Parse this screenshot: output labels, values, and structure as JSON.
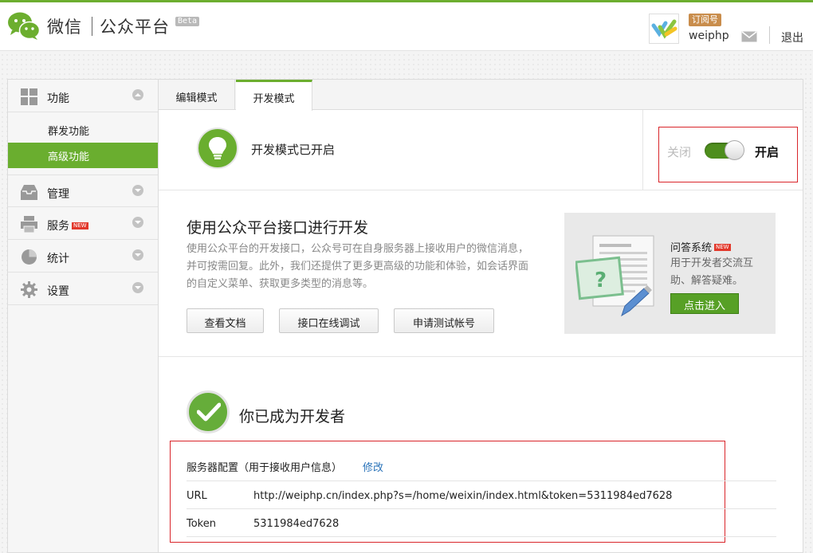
{
  "header": {
    "brand": "微信",
    "product": "公众平台",
    "beta": "Beta",
    "account_badge": "订阅号",
    "username": "weiphp",
    "logout": "退出"
  },
  "sidebar": {
    "groups": [
      {
        "label": "功能",
        "icon": "grid-icon",
        "expanded": true
      },
      {
        "label": "管理",
        "icon": "inbox-icon"
      },
      {
        "label": "服务",
        "icon": "printer-icon",
        "badge": "NEW"
      },
      {
        "label": "统计",
        "icon": "pie-chart-icon"
      },
      {
        "label": "设置",
        "icon": "gear-icon"
      }
    ],
    "sub_items": [
      {
        "label": "群发功能",
        "active": false
      },
      {
        "label": "高级功能",
        "active": true
      }
    ]
  },
  "tabs": [
    {
      "label": "编辑模式",
      "active": false
    },
    {
      "label": "开发模式",
      "active": true
    }
  ],
  "status": {
    "text": "开发模式已开启",
    "off_label": "关闭",
    "on_label": "开启",
    "enabled": true
  },
  "api": {
    "title": "使用公众平台接口进行开发",
    "description": "使用公众平台的开发接口，公众号可在自身服务器上接收用户的微信消息，并可按需回复。此外，我们还提供了更多更高级的功能和体验，如会话界面的自定义菜单、获取更多类型的消息等。",
    "buttons": {
      "docs": "查看文档",
      "debug": "接口在线调试",
      "test_account": "申请测试帐号"
    }
  },
  "qa_card": {
    "title": "问答系统",
    "badge": "NEW",
    "description": "用于开发者交流互助、解答疑难。",
    "button": "点击进入"
  },
  "developer": {
    "title": "你已成为开发者",
    "config_heading": "服务器配置（用于接收用户信息）",
    "edit_link": "修改",
    "url_key": "URL",
    "url_value": "http://weiphp.cn/index.php?s=/home/weixin/index.html&token=5311984ed7628",
    "token_key": "Token",
    "token_value": "5311984ed7628"
  },
  "colors": {
    "brand_green": "#6cae2f",
    "highlight_red": "#d9252a",
    "link_blue": "#2a73b9"
  }
}
